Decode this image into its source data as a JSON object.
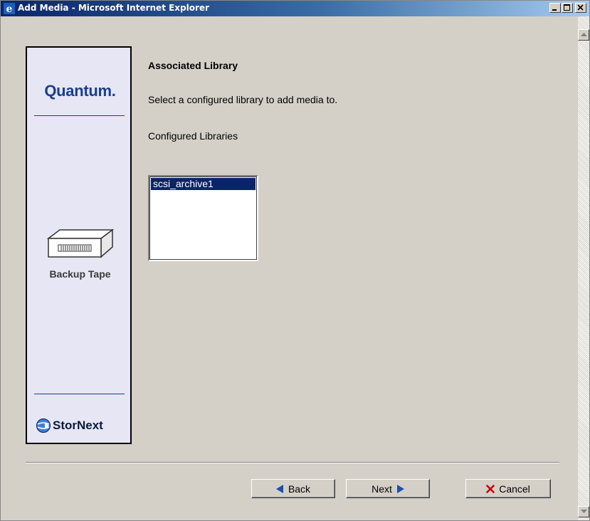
{
  "window": {
    "title": "Add Media - Microsoft Internet Explorer"
  },
  "sidebar": {
    "brand_logo_text": "Quantum.",
    "category_icon": "tape-drive-icon",
    "category_label": "Backup Tape",
    "product_logo_text": "StorNext"
  },
  "main": {
    "heading": "Associated Library",
    "instruction": "Select a configured library to add media to.",
    "list_label": "Configured Libraries",
    "libraries": [
      "scsi_archive1"
    ],
    "selected_library": "scsi_archive1"
  },
  "buttons": {
    "back_label": "Back",
    "next_label": "Next",
    "cancel_label": "Cancel"
  },
  "colors": {
    "title_bar": "#0a246a",
    "selection": "#0a246a",
    "brand_blue": "#1a3f8c",
    "cancel_x": "#cc0000",
    "nav_arrow": "#1f4fa8"
  }
}
